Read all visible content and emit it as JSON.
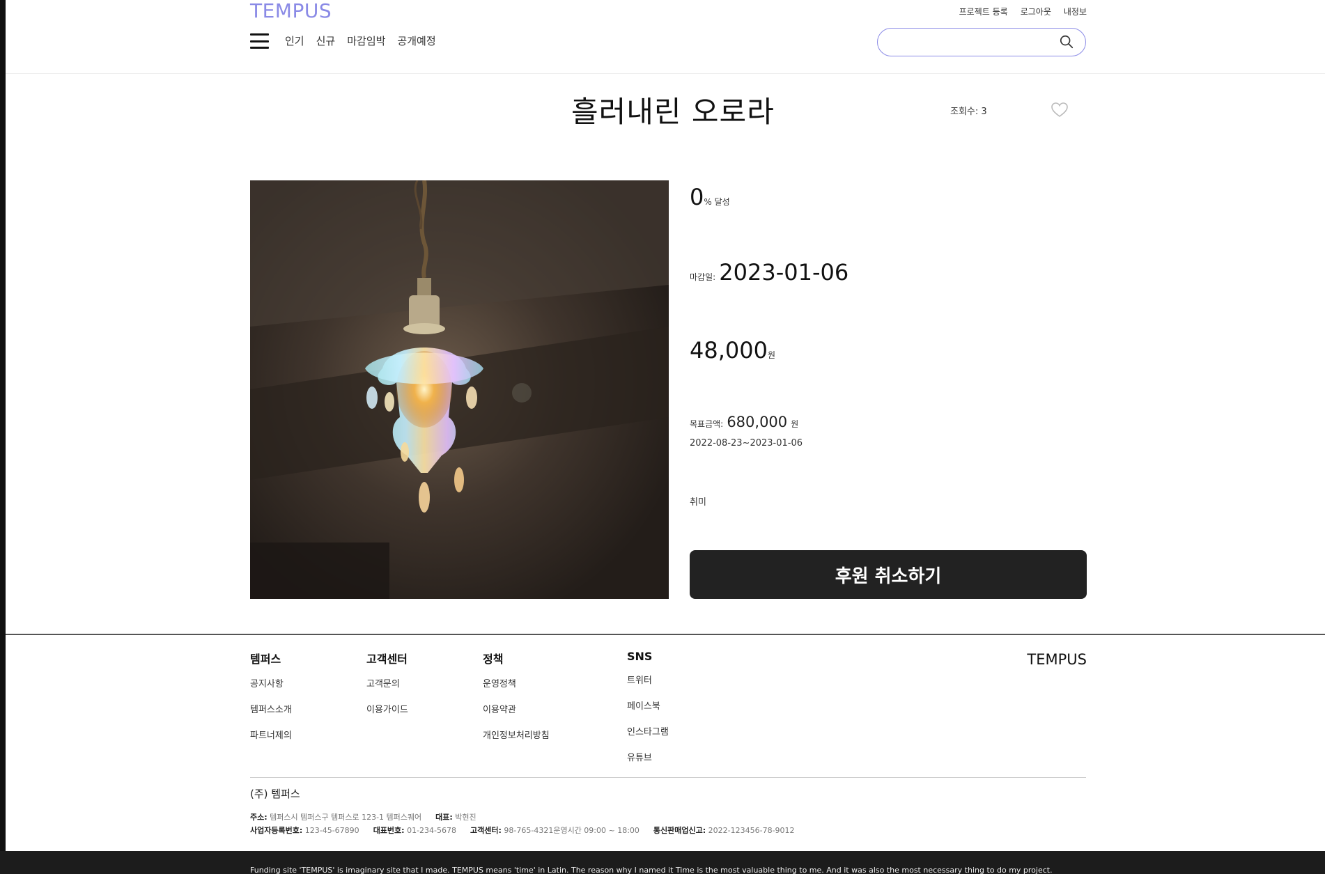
{
  "header": {
    "logo": "TEMPUS",
    "top_links": [
      "프로젝트 등록",
      "로그아웃",
      "내정보"
    ],
    "nav": [
      "인기",
      "신규",
      "마감임박",
      "공개예정"
    ],
    "search_placeholder": ""
  },
  "project": {
    "title": "흘러내린 오로라",
    "views_label": "조회수: 3",
    "achievement_value": "0",
    "achievement_suffix": "% 달성",
    "deadline_label": "마감일:",
    "deadline_value": "2023-01-06",
    "price_value": "48,000",
    "price_unit": "원",
    "goal_label": "목표금액:",
    "goal_value": "680,000",
    "goal_unit": "원",
    "period": "2022-08-23~2023-01-06",
    "category": "취미",
    "cta_label": "후원 취소하기",
    "image_alt": "dripping iridescent glass pendant lamp"
  },
  "footer": {
    "columns": [
      {
        "title": "템퍼스",
        "items": [
          "공지사항",
          "템퍼스소개",
          "파트너제의"
        ]
      },
      {
        "title": "고객센터",
        "items": [
          "고객문의",
          "이용가이드"
        ]
      },
      {
        "title": "정책",
        "items": [
          "운영정책",
          "이용약관",
          "개인정보처리방침"
        ]
      },
      {
        "title": "SNS",
        "items": [
          "트위터",
          "페이스북",
          "인스타그램",
          "유튜브"
        ]
      }
    ],
    "brand": "TEMPUS",
    "company": "(주) 템퍼스",
    "address_label": "주소:",
    "address": "템퍼스시 템퍼스구 템퍼스로 123-1 템퍼스퀘어",
    "ceo_label": "대표:",
    "ceo": "박현진",
    "biz_label": "사업자등록번호:",
    "biz": "123-45-67890",
    "tel_label": "대표번호:",
    "tel": "01-234-5678",
    "cs_label": "고객센터:",
    "cs": "98-765-4321운영시간 09:00 ~ 18:00",
    "mail_label": "통신판매업신고:",
    "mail": "2022-123456-78-9012",
    "disclaimer": "Funding site 'TEMPUS' is imaginary site that I made. TEMPUS means 'time' in Latin. The reason why I named it Time is the most valuable thing to me. And it was also the most necessary thing to do my project."
  }
}
